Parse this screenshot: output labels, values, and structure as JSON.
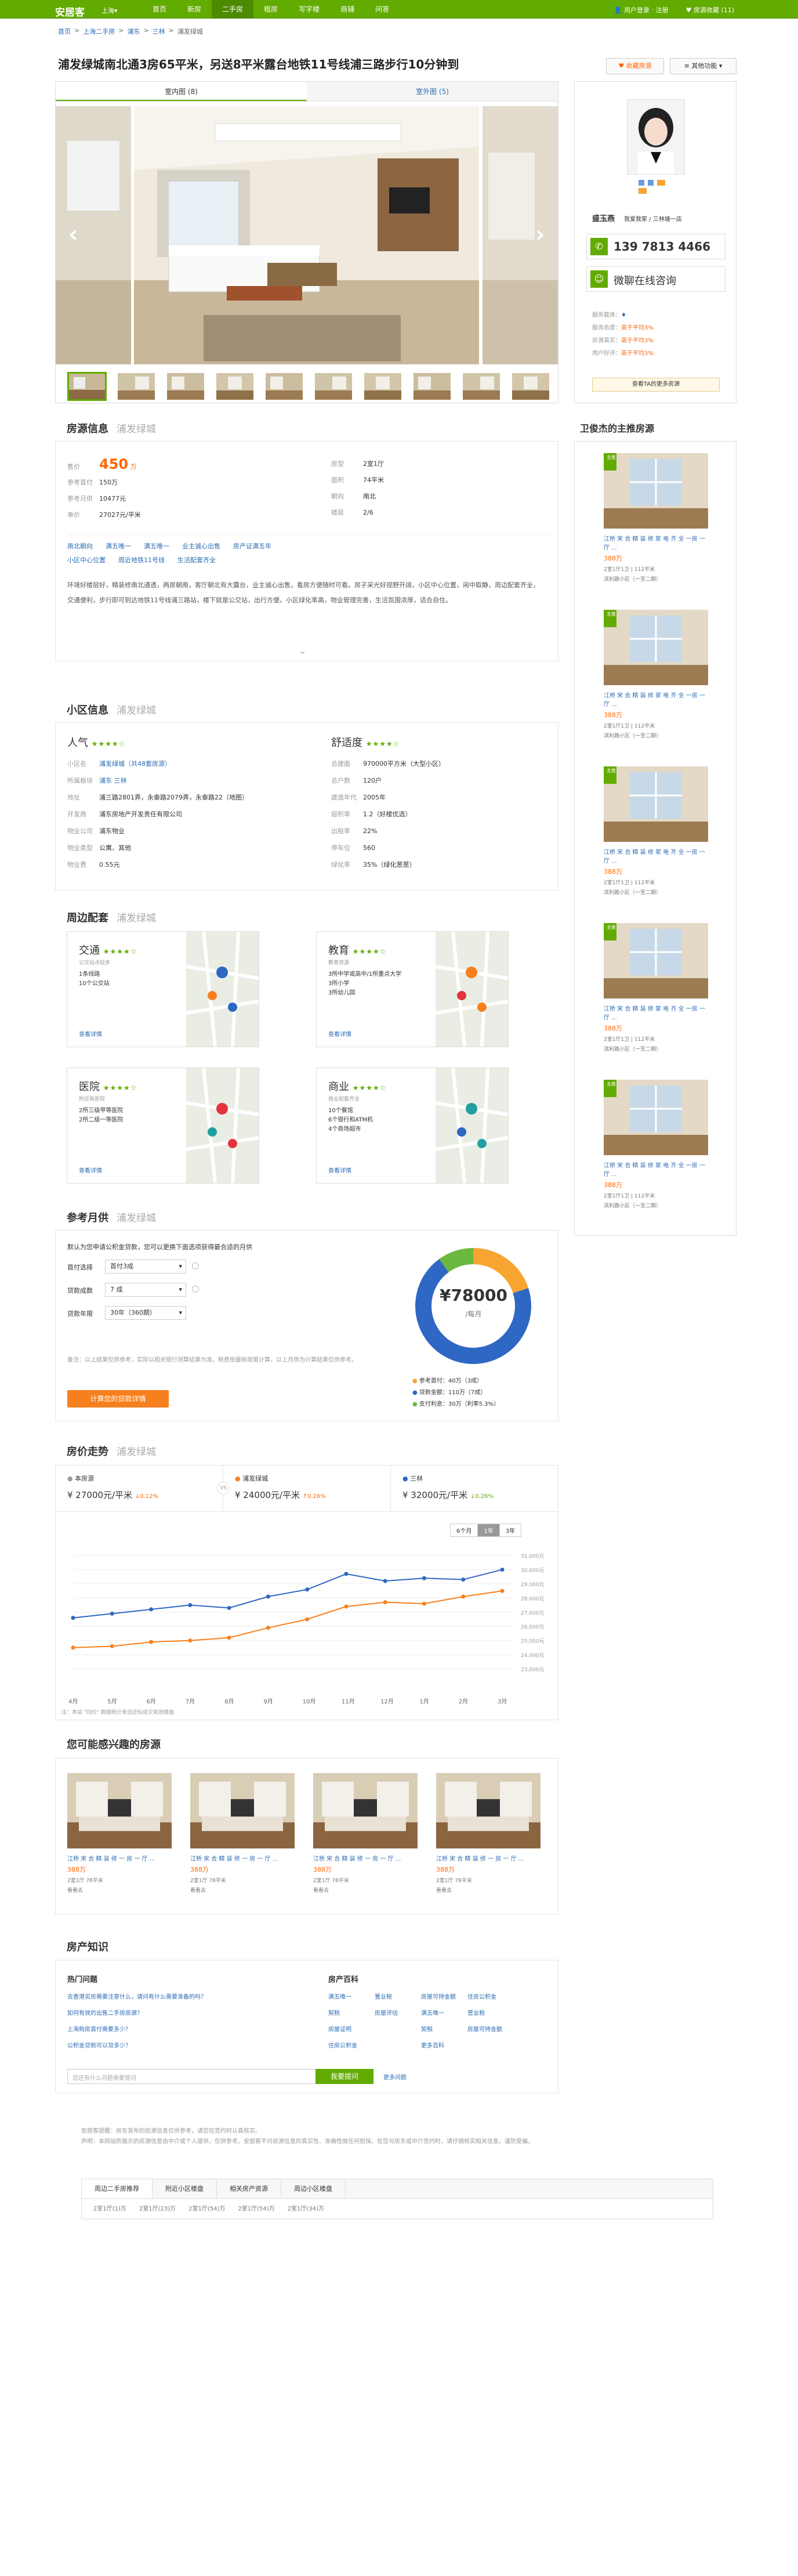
{
  "topbar": {
    "logo": "安居客",
    "city": "上海▾",
    "nav": [
      "首页",
      "新房",
      "二手房",
      "租房",
      "写字楼",
      "商铺",
      "问答"
    ],
    "active_nav": 2,
    "user": "用户登录 · 注册",
    "fav": "房源收藏 (11)"
  },
  "breadcrumb": [
    "首页",
    "上海二手房",
    "浦东",
    "三林",
    "浦发绿城"
  ],
  "title": "浦发绿城南北通3房65平米，另送8平米露台地铁11号线浦三路步行10分钟到",
  "buttons": {
    "favorite": "♥ 收藏房源",
    "more": "≡ 其他功能 ▾"
  },
  "photo_tabs": [
    "室内图 (8)",
    "室外图 (5)"
  ],
  "agent": {
    "name": "盛玉燕",
    "company": "我爱我家 / 三林塘一店",
    "phone": "139 7813 4466",
    "wechat": "微聊在线咨询",
    "stats": [
      {
        "label": "服务载体：",
        "value": "高于平均3%"
      },
      {
        "label": "服务态度：",
        "value": "高于平均3%"
      },
      {
        "label": "房源真实：",
        "value": "高于平均3%"
      },
      {
        "label": "用户好评：",
        "value": "高于平均3%"
      }
    ],
    "more_btn": "查看TA的更多房源",
    "listings_title": "卫俊杰的主推房源"
  },
  "listings": [
    {
      "title": "江桥 宋 合 精 装 修 家 电 齐 全 一房 一厅 ...",
      "price": "388万",
      "spec": "2室1厅1卫 | 112平米",
      "community": "滨利路小区（一至二期）"
    },
    {
      "title": "江桥 宋 合 精 装 修 家 电 齐 全 一房 一厅 ...",
      "price": "388万",
      "spec": "2室1厅1卫 | 112平米",
      "community": "滨利路小区（一至二期）"
    },
    {
      "title": "江桥 宋 合 精 装 修 家 电 齐 全 一房 一厅 ...",
      "price": "388万",
      "spec": "2室1厅1卫 | 112平米",
      "community": "滨利路小区（一至二期）"
    },
    {
      "title": "江桥 宋 合 精 装 修 家 电 齐 全 一房 一厅 ...",
      "price": "388万",
      "spec": "2室1厅1卫 | 112平米",
      "community": "滨利路小区（一至二期）"
    },
    {
      "title": "江桥 宋 合 精 装 修 家 电 齐 全 一房 一厅 ...",
      "price": "388万",
      "spec": "2室1厅1卫 | 112平米",
      "community": "滨利路小区（一至二期）"
    }
  ],
  "house_info": {
    "heading": "房源信息",
    "sub": "浦发绿城",
    "price_label": "售价",
    "price": "450",
    "price_unit": "万",
    "left": [
      {
        "k": "参考首付",
        "v": "150万"
      },
      {
        "k": "参考月供",
        "v": "10477元"
      },
      {
        "k": "单价",
        "v": "27027元/平米"
      }
    ],
    "right": [
      {
        "k": "房型",
        "v": "2室1厅"
      },
      {
        "k": "面积",
        "v": "74平米"
      },
      {
        "k": "朝向",
        "v": "南北"
      },
      {
        "k": "楼层",
        "v": "2/6"
      }
    ],
    "tags": [
      "南北朝向",
      "满五唯一",
      "满五唯一",
      "业主诚心出售",
      "房产证满五年"
    ],
    "tags2": [
      "小区中心位置",
      "周近地铁11号线",
      "生活配套齐全"
    ],
    "desc": "环境好楼层好，精装修南北通透，两房朝南，客厅朝北有大露台，业主诚心出售，看房方便随时可看。房子采光好视野开阔，小区中心位置，闹中取静，周边配套齐全，交通便利，步行即可到达地铁11号线浦三路站，楼下就是公交站，出行方便。小区绿化率高，物业管理完善，生活氛围浓厚，适合自住。"
  },
  "community": {
    "heading": "小区信息",
    "sub": "浦发绿城",
    "popularity": "人气",
    "comfort": "舒适度",
    "left": [
      {
        "k": "小区名",
        "v": "浦发绿城（共48套房源）"
      },
      {
        "k": "所属板块",
        "v": "浦东 三林"
      },
      {
        "k": "地址",
        "v": "浦三路2801弄，永泰路2079弄，永泰路22（地图）"
      },
      {
        "k": "开发商",
        "v": "浦东房地产开发责任有限公司"
      },
      {
        "k": "物业公司",
        "v": "浦东物业"
      },
      {
        "k": "物业类型",
        "v": "公寓、其他"
      },
      {
        "k": "物业费",
        "v": "0.55元"
      }
    ],
    "right": [
      {
        "k": "总建面",
        "v": "970000平方米（大型小区）"
      },
      {
        "k": "总户数",
        "v": "120户"
      },
      {
        "k": "建造年代",
        "v": "2005年"
      },
      {
        "k": "容积率",
        "v": "1.2（好楼优选）"
      },
      {
        "k": "出租率",
        "v": "22%"
      },
      {
        "k": "停车位",
        "v": "560"
      },
      {
        "k": "绿化率",
        "v": "35%（绿化葱葱）"
      }
    ]
  },
  "surroundings": {
    "heading": "周边配套",
    "sub": "浦发绿城",
    "cards": [
      {
        "name": "交通",
        "desc": "公交站点较多",
        "lines": [
          "1条线路",
          "10个公交站"
        ],
        "more": "查看详情"
      },
      {
        "name": "教育",
        "desc": "教育资源",
        "lines": [
          "3所中学或高中/1所重点大学",
          "3所小学",
          "3所幼儿园"
        ],
        "more": "查看详情"
      },
      {
        "name": "医院",
        "desc": "附近有医院",
        "lines": [
          "2所三级甲等医院",
          "2所二级一等医院"
        ],
        "more": "查看详情"
      },
      {
        "name": "商业",
        "desc": "商业配套齐全",
        "lines": [
          "10个餐馆",
          "6个银行和ATM机",
          "4个商场超市"
        ],
        "more": "查看详情"
      }
    ]
  },
  "mortgage": {
    "heading": "参考月供",
    "sub": "浦发绿城",
    "hint": "默认为您申请公积金贷款，您可以更换下面选项获得最合适的月供",
    "rows": [
      {
        "k": "首付选择",
        "v": "首付3成"
      },
      {
        "k": "贷款成数",
        "v": "7 成"
      },
      {
        "k": "贷款年限",
        "v": "30年（360期）"
      }
    ],
    "note": "备注：以上结果仅供参考，实际以相关银行测算结果为准。税费按最新政策计算，以上月供为计算结果仅供参考。",
    "btn": "计算您的贷款详情",
    "total": "¥78000",
    "total_unit": "/每月",
    "legend": [
      {
        "label": "参考首付：40万（3成）",
        "color": "#f7a431"
      },
      {
        "label": "贷款金额：110万（7成）",
        "color": "#2e67c4"
      },
      {
        "label": "支付利息：30万（利率5.3%）",
        "color": "#6bb83f"
      }
    ],
    "share": [
      0.2,
      0.7,
      0.1
    ]
  },
  "trend": {
    "heading": "房价走势",
    "sub": "浦发绿城",
    "cols": [
      {
        "name": "本房源",
        "price": "¥ 27000元/平米",
        "chg": "↓0.12%",
        "color": "#999"
      },
      {
        "name": "浦发绿城",
        "price": "¥ 24000元/平米",
        "chg": "↑0.26%",
        "color": "#f7801e"
      },
      {
        "name": "三林",
        "price": "¥ 32000元/平米",
        "chg": "↓0.26%",
        "color": "#2e67c4"
      }
    ],
    "ranges": [
      "6个月",
      "1年",
      "3年"
    ],
    "active_range": 1,
    "note": "注：本站 \"均价\" 数据统计来自近似成交有效楼盘"
  },
  "chart_data": {
    "type": "line",
    "x": [
      "4月",
      "5月",
      "6月",
      "7月",
      "8月",
      "9月",
      "10月",
      "11月",
      "12月",
      "1月",
      "2月",
      "3月"
    ],
    "series": [
      {
        "name": "浦发绿城",
        "values": [
          24500,
          24600,
          24900,
          25000,
          25200,
          25900,
          26500,
          27400,
          27700,
          27600,
          28100,
          28500
        ]
      },
      {
        "name": "三林",
        "values": [
          26600,
          26900,
          27200,
          27500,
          27300,
          28100,
          28600,
          29700,
          29200,
          29400,
          29300,
          30000
        ]
      }
    ],
    "ylim": [
      22000,
      31000
    ],
    "yticks": [
      "31,000元",
      "30,000元",
      "29,000元",
      "28,000元",
      "27,000元",
      "26,000元",
      "25,000元",
      "24,000元",
      "23,000元"
    ]
  },
  "interest": {
    "heading": "您可能感兴趣的房源",
    "items": [
      {
        "title": "江桥 宋 合 精 装 修 一 房 一 厅 ...",
        "price": "388万",
        "spec": "2室1厅 78平米",
        "tag": "看看去"
      },
      {
        "title": "江桥 宋 合 精 装 修 一 房 一 厅 ...",
        "price": "388万",
        "spec": "2室1厅 78平米",
        "tag": "看看去"
      },
      {
        "title": "江桥 宋 合 精 装 修 一 房 一 厅 ...",
        "price": "388万",
        "spec": "2室1厅 78平米",
        "tag": "看看去"
      },
      {
        "title": "江桥 宋 合 精 装 修 一 房 一 厅 ...",
        "price": "388万",
        "spec": "2室1厅 78平米",
        "tag": "看看去"
      }
    ]
  },
  "knowledge": {
    "heading": "房产知识",
    "hot_title": "热门问题",
    "hot": [
      "去香港买房需要注意什么，请问有什么需要准备的吗？",
      "如何有效的出售二手房房源？",
      "上海购房首付需要多少？",
      "公积金贷款可以贷多少？"
    ],
    "enc_title": "房产百科",
    "enc": [
      "满五唯一",
      "置业税",
      "房屋可持金额",
      "住房公积金",
      "契税",
      "房屋评估",
      "满五唯一",
      "营业税",
      "房屋证明",
      "",
      "契税",
      "房屋可持金额",
      "住房公积金",
      "",
      "更多百科"
    ],
    "search_placeholder": "您还有什么问题需要提问",
    "ask_btn": "我要提问",
    "more": "更多问题"
  },
  "disclaimer": [
    "安居客提醒：房东发布的房源信息仅供参考，请您在签约时认真核实。",
    "声明：本网站所展示的房源信息由中介或个人提供，仅供参考。安居客不对房源信息的真实性、准确性做任何担保。在您与房东或中介签约时，请仔细核实相关信息，谨防受骗。"
  ],
  "bottom_tabs": [
    "周边二手房推荐",
    "附近小区楼盘",
    "相关房产资源",
    "周边小区楼盘"
  ],
  "bottom_links": [
    "2室1厅(1)万",
    "2室1厅(23)万",
    "2室1厅(54)万",
    "2室1厅(54)万",
    "2室1厅(34)万"
  ],
  "colors": {
    "brand": "#62ab00",
    "link": "#2a6bb3",
    "price": "#f60"
  }
}
